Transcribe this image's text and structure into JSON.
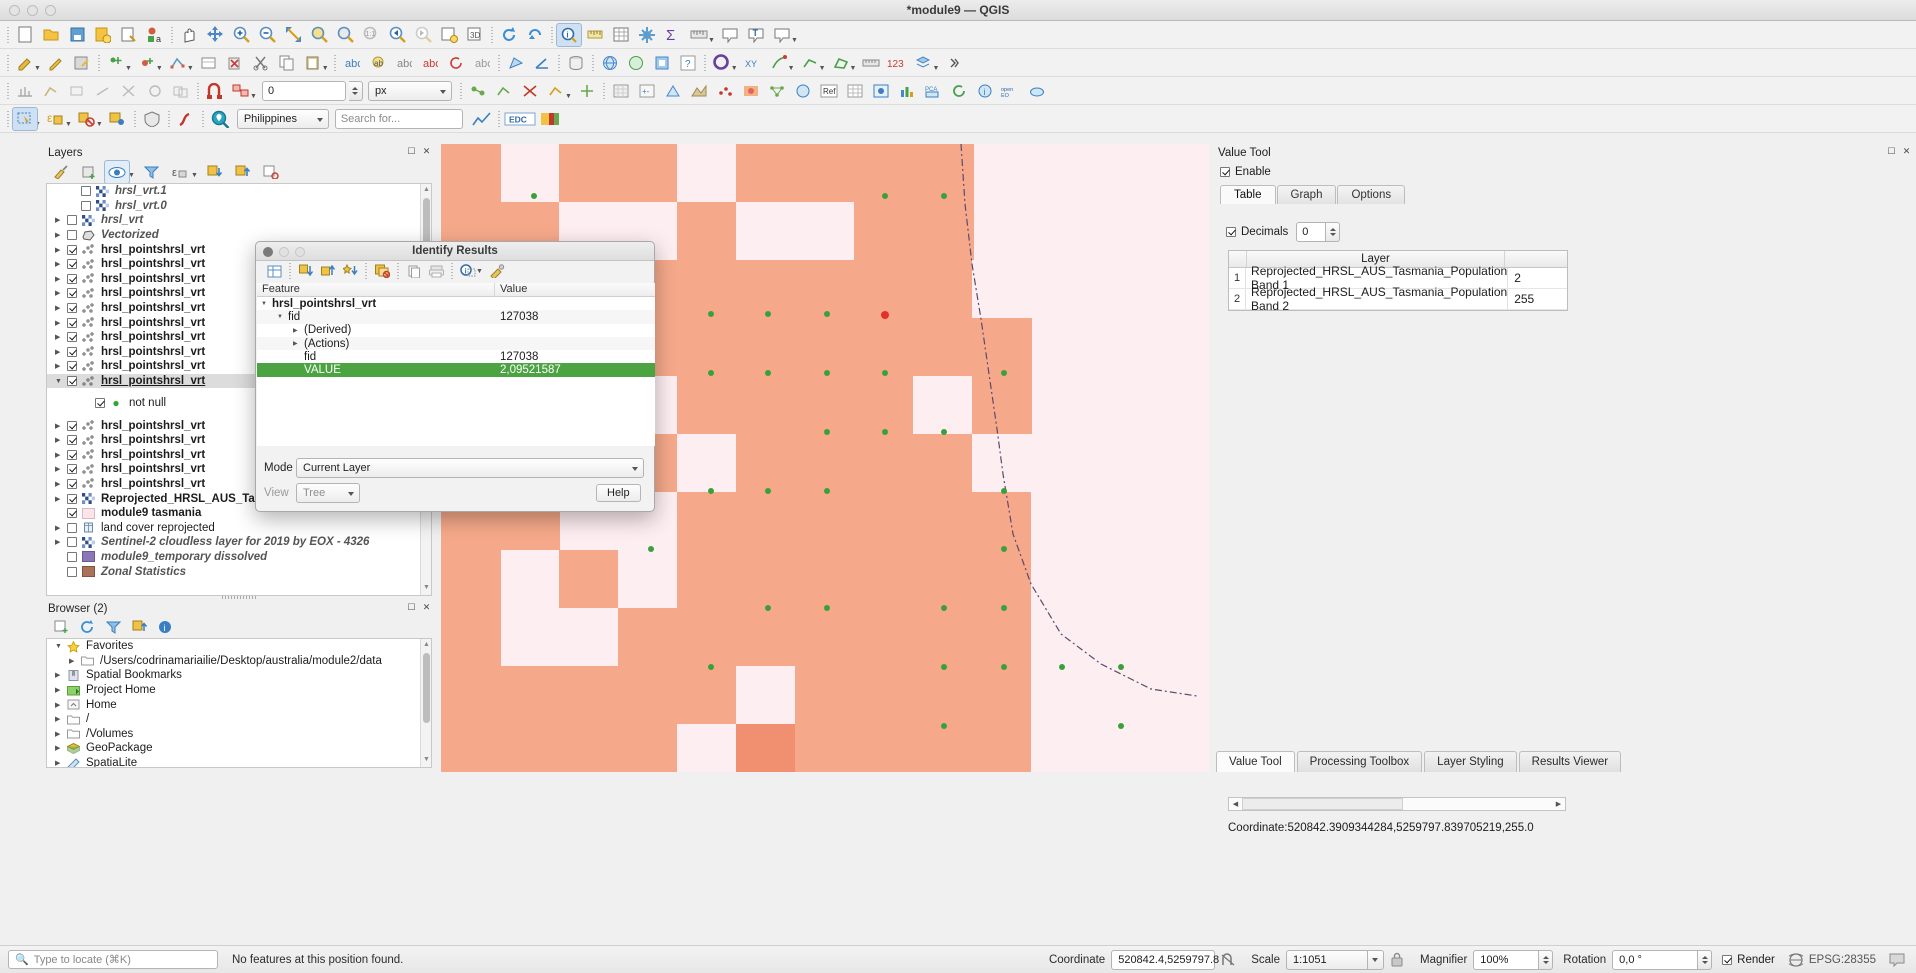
{
  "window": {
    "title": "*module9 — QGIS"
  },
  "toolbars": {
    "row1": [
      {
        "icon": "new-project-icon"
      },
      {
        "icon": "open-project-icon"
      },
      {
        "icon": "save-project-icon"
      },
      {
        "icon": "save-project-as-icon"
      },
      {
        "icon": "new-print-layout-icon"
      },
      {
        "icon": "style-manager-icon"
      },
      {
        "sep": true
      },
      {
        "icon": "pan-map-icon"
      },
      {
        "icon": "pan-to-selection-icon"
      },
      {
        "icon": "zoom-in-icon"
      },
      {
        "icon": "zoom-out-icon"
      },
      {
        "icon": "zoom-full-icon"
      },
      {
        "icon": "zoom-to-selection-icon"
      },
      {
        "icon": "zoom-to-layer-icon"
      },
      {
        "icon": "zoom-native-icon"
      },
      {
        "icon": "zoom-last-icon"
      },
      {
        "icon": "zoom-next-icon"
      },
      {
        "icon": "new-map-view-icon"
      },
      {
        "icon": "new-3d-map-view-icon"
      },
      {
        "sep": true
      },
      {
        "icon": "refresh-icon"
      },
      {
        "icon": "draw-map-icon"
      },
      {
        "sep": true
      },
      {
        "icon": "identify-features-icon",
        "active": true
      },
      {
        "icon": "measure-line-icon"
      },
      {
        "icon": "attribute-table-icon"
      },
      {
        "icon": "processing-toolbox-icon"
      },
      {
        "icon": "sum-statistics-icon"
      },
      {
        "icon": "measure-icon"
      },
      {
        "icon": "map-tips-icon"
      },
      {
        "icon": "text-annotation-icon"
      },
      {
        "icon": "annotation-icon"
      }
    ],
    "row2": [
      {
        "icon": "current-edits-icon"
      },
      {
        "icon": "toggle-editing-icon"
      },
      {
        "icon": "save-layer-edits-icon"
      },
      {
        "sep": true
      },
      {
        "icon": "add-feature-icon"
      },
      {
        "icon": "add-point-feature-icon"
      },
      {
        "icon": "vertex-tool-icon"
      },
      {
        "icon": "modify-attributes-icon"
      },
      {
        "icon": "delete-selected-icon"
      },
      {
        "icon": "cut-features-icon"
      },
      {
        "icon": "copy-features-icon"
      },
      {
        "icon": "paste-features-icon"
      },
      {
        "sep": true
      },
      {
        "icon": "label-icon"
      },
      {
        "icon": "pin-labels-icon"
      },
      {
        "icon": "show-hide-labels-icon"
      },
      {
        "icon": "move-label-icon"
      },
      {
        "icon": "rotate-label-icon"
      },
      {
        "icon": "change-label-icon"
      },
      {
        "sep": true
      },
      {
        "icon": "measure-area-icon"
      },
      {
        "icon": "measure-angle-icon"
      },
      {
        "sep": true
      },
      {
        "icon": "db-manager-icon"
      },
      {
        "sep": true
      },
      {
        "icon": "globe-icon"
      },
      {
        "icon": "metasearch-icon"
      },
      {
        "icon": "plugins-icon"
      },
      {
        "icon": "help-icon"
      },
      {
        "sep": true
      },
      {
        "icon": "circle-select-icon"
      },
      {
        "icon": "xy-tool-icon"
      },
      {
        "icon": "vector-point-icon"
      },
      {
        "icon": "vector-line-icon"
      },
      {
        "icon": "vector-polygon-icon"
      },
      {
        "icon": "ruler-icon"
      },
      {
        "icon": "numeric-123-icon"
      },
      {
        "icon": "layer-stack-icon"
      },
      {
        "icon": "chevron-right-icon"
      }
    ],
    "row3": [
      {
        "icon": "snapping-off-icon"
      },
      {
        "icon": "digitize-toggle-icon"
      },
      {
        "icon": "snap-vertex-icon"
      },
      {
        "icon": "snap-segment-icon"
      },
      {
        "icon": "snap-intersection-icon"
      },
      {
        "icon": "trace-icon"
      },
      {
        "icon": "avoid-overlap-icon"
      },
      {
        "sep": true
      },
      {
        "icon": "snapping-enable-icon",
        "active": true
      },
      {
        "icon": "snap-mode-icon"
      },
      {
        "widget": "tolerance",
        "value": "0"
      },
      {
        "widget": "units",
        "value": "px"
      },
      {
        "sep": true
      },
      {
        "icon": "topological-editing-icon"
      },
      {
        "icon": "self-snapping-icon"
      },
      {
        "icon": "no-overlap-icon"
      },
      {
        "icon": "point-marker-icon"
      },
      {
        "icon": "intersection-snap-icon"
      },
      {
        "sep": true
      },
      {
        "icon": "georeferencer-icon"
      },
      {
        "icon": "raster-calc-icon"
      },
      {
        "icon": "mesh-calc-icon"
      },
      {
        "icon": "terrain-icon"
      },
      {
        "icon": "interpolation-icon"
      },
      {
        "icon": "heatmap-icon"
      },
      {
        "icon": "network-analysis-icon"
      },
      {
        "icon": "qweb-icon"
      },
      {
        "icon": "ref-icon"
      },
      {
        "icon": "grid-icon"
      },
      {
        "icon": "semi-auto-icon"
      },
      {
        "icon": "stats-icon"
      },
      {
        "icon": "pca-icon"
      },
      {
        "icon": "swipe-icon"
      },
      {
        "icon": "info-layer-icon"
      },
      {
        "icon": "open-eo-icon"
      },
      {
        "icon": "cloud-icon"
      }
    ],
    "row4": [
      {
        "icon": "select-features-icon",
        "active": true
      },
      {
        "icon": "select-by-expression-icon"
      },
      {
        "icon": "deselect-icon"
      },
      {
        "icon": "select-value-icon"
      },
      {
        "sep": true
      },
      {
        "icon": "shield-icon"
      },
      {
        "sep": true
      },
      {
        "icon": "curve-icon"
      },
      {
        "sep": true
      },
      {
        "icon": "search-location-icon"
      },
      {
        "widget": "country",
        "value": "Philippines"
      },
      {
        "widget": "search",
        "value": "",
        "placeholder": "Search for..."
      },
      {
        "icon": "profile-chart-icon"
      },
      {
        "sep": true
      },
      {
        "icon": "edc-icon"
      },
      {
        "icon": "colorbar-icon"
      }
    ],
    "toleranceValue": "0",
    "unitsValue": "px",
    "countryValue": "Philippines",
    "searchPlaceholder": "Search for..."
  },
  "layers_panel": {
    "title": "Layers",
    "toolbar_icons": [
      "open-styling-panel-icon",
      "add-group-icon",
      "manage-visibility-icon",
      "filter-legend-icon",
      "filter-legend-expression-icon",
      "expand-all-icon",
      "collapse-all-icon",
      "remove-layer-icon"
    ],
    "items": [
      {
        "arrow": "",
        "checked": false,
        "label": "hrsl_vrt.1",
        "style": "it",
        "icon": "raster-icon",
        "indent": 1
      },
      {
        "arrow": "",
        "checked": false,
        "label": "hrsl_vrt.0",
        "style": "it",
        "icon": "raster-icon",
        "indent": 1
      },
      {
        "arrow": "closed",
        "checked": false,
        "label": "hrsl_vrt",
        "style": "it",
        "icon": "raster-icon",
        "indent": 0
      },
      {
        "arrow": "closed",
        "checked": false,
        "label": "Vectorized",
        "style": "it",
        "icon": "polygon-icon",
        "indent": 0
      },
      {
        "arrow": "closed",
        "checked": true,
        "label": "hrsl_pointshrsl_vrt",
        "style": "b",
        "icon": "points-icon",
        "indent": 0
      },
      {
        "arrow": "closed",
        "checked": true,
        "label": "hrsl_pointshrsl_vrt",
        "style": "b",
        "icon": "points-icon",
        "indent": 0
      },
      {
        "arrow": "closed",
        "checked": true,
        "label": "hrsl_pointshrsl_vrt",
        "style": "b",
        "icon": "points-icon",
        "indent": 0
      },
      {
        "arrow": "closed",
        "checked": true,
        "label": "hrsl_pointshrsl_vrt",
        "style": "b",
        "icon": "points-icon",
        "indent": 0
      },
      {
        "arrow": "closed",
        "checked": true,
        "label": "hrsl_pointshrsl_vrt",
        "style": "b",
        "icon": "points-icon",
        "indent": 0
      },
      {
        "arrow": "closed",
        "checked": true,
        "label": "hrsl_pointshrsl_vrt",
        "style": "b",
        "icon": "points-icon",
        "indent": 0
      },
      {
        "arrow": "closed",
        "checked": true,
        "label": "hrsl_pointshrsl_vrt",
        "style": "b",
        "icon": "points-icon",
        "indent": 0
      },
      {
        "arrow": "closed",
        "checked": true,
        "label": "hrsl_pointshrsl_vrt",
        "style": "b",
        "icon": "points-icon",
        "indent": 0
      },
      {
        "arrow": "closed",
        "checked": true,
        "label": "hrsl_pointshrsl_vrt",
        "style": "b",
        "icon": "points-icon",
        "indent": 0
      },
      {
        "arrow": "open",
        "checked": true,
        "label": "hrsl_pointshrsl_vrt",
        "style": "b ul",
        "icon": "points-icon",
        "indent": 0,
        "selected": true
      },
      {
        "arrow": "",
        "checked": true,
        "label": "not null",
        "style": "plain",
        "icon": "green-dot-icon",
        "indent": 2,
        "legend": true
      },
      {
        "arrow": "closed",
        "checked": true,
        "label": "hrsl_pointshrsl_vrt",
        "style": "b",
        "icon": "points-icon",
        "indent": 0
      },
      {
        "arrow": "closed",
        "checked": true,
        "label": "hrsl_pointshrsl_vrt",
        "style": "b",
        "icon": "points-icon",
        "indent": 0
      },
      {
        "arrow": "closed",
        "checked": true,
        "label": "hrsl_pointshrsl_vrt",
        "style": "b",
        "icon": "points-icon",
        "indent": 0
      },
      {
        "arrow": "closed",
        "checked": true,
        "label": "hrsl_pointshrsl_vrt",
        "style": "b",
        "icon": "points-icon",
        "indent": 0
      },
      {
        "arrow": "closed",
        "checked": true,
        "label": "hrsl_pointshrsl_vrt",
        "style": "b",
        "icon": "points-icon",
        "indent": 0
      },
      {
        "arrow": "closed",
        "checked": true,
        "label": "Reprojected_HRSL_AUS_Tasmania_Population",
        "style": "b",
        "icon": "raster-icon",
        "indent": 0
      },
      {
        "arrow": "",
        "checked": true,
        "label": "module9 tasmania",
        "style": "b",
        "icon": "pink-swatch-icon",
        "indent": 0
      },
      {
        "arrow": "closed",
        "checked": false,
        "label": "land cover reprojected",
        "style": "plain",
        "icon": "mesh-icon",
        "indent": 0
      },
      {
        "arrow": "closed",
        "checked": false,
        "label": "Sentinel-2 cloudless layer for 2019 by EOX - 4326",
        "style": "it",
        "icon": "raster-icon",
        "indent": 0
      },
      {
        "arrow": "",
        "checked": false,
        "label": "module9_temporary dissolved",
        "style": "it",
        "icon": "purple-swatch-icon",
        "indent": 0
      },
      {
        "arrow": "",
        "checked": false,
        "label": "Zonal Statistics",
        "style": "it",
        "icon": "brown-swatch-icon",
        "indent": 0
      }
    ]
  },
  "browser_panel": {
    "title": "Browser (2)",
    "toolbar_icons": [
      "add-layer-icon",
      "refresh-icon",
      "filter-browser-icon",
      "collapse-all-icon",
      "properties-icon"
    ],
    "items": [
      {
        "arrow": "open",
        "label": "Favorites",
        "icon": "star-icon",
        "indent": 0
      },
      {
        "arrow": "closed",
        "label": "/Users/codrinamariailie/Desktop/australia/module2/data",
        "icon": "folder-icon",
        "indent": 1
      },
      {
        "arrow": "closed",
        "label": "Spatial Bookmarks",
        "icon": "bookmark-icon",
        "indent": 0
      },
      {
        "arrow": "closed",
        "label": "Project Home",
        "icon": "project-home-icon",
        "indent": 0
      },
      {
        "arrow": "closed",
        "label": "Home",
        "icon": "home-icon",
        "indent": 0
      },
      {
        "arrow": "closed",
        "label": "/",
        "icon": "folder-icon",
        "indent": 0
      },
      {
        "arrow": "closed",
        "label": "/Volumes",
        "icon": "folder-icon",
        "indent": 0
      },
      {
        "arrow": "closed",
        "label": "GeoPackage",
        "icon": "geopackage-icon",
        "indent": 0
      },
      {
        "arrow": "closed",
        "label": "SpatiaLite",
        "icon": "spatialite-icon",
        "indent": 0
      }
    ]
  },
  "identify_dialog": {
    "title": "Identify Results",
    "toolbar_icons": [
      "expand-new-icon",
      "expand-all-icon",
      "collapse-all-icon",
      "highlight-all-icon",
      "clear-results-icon",
      "copy-icon",
      "print-icon",
      "identify-settings-icon",
      "chevron-down-icon",
      "wrench-icon"
    ],
    "columns": {
      "feature": "Feature",
      "value": "Value"
    },
    "rows": [
      {
        "arrow": "open",
        "indent": 0,
        "label": "hrsl_pointshrsl_vrt",
        "value": "",
        "bold": true
      },
      {
        "arrow": "open",
        "indent": 1,
        "label": "fid",
        "value": "127038"
      },
      {
        "arrow": "closed",
        "indent": 2,
        "label": "(Derived)",
        "value": ""
      },
      {
        "arrow": "closed",
        "indent": 2,
        "label": "(Actions)",
        "value": ""
      },
      {
        "arrow": "",
        "indent": 2,
        "label": "fid",
        "value": "127038"
      },
      {
        "arrow": "",
        "indent": 2,
        "label": "VALUE",
        "value": "2,09521587",
        "highlight": true
      }
    ],
    "mode_label": "Mode",
    "mode_value": "Current Layer",
    "view_label": "View",
    "view_value": "Tree",
    "help_label": "Help"
  },
  "value_tool": {
    "title": "Value Tool",
    "enable_label": "Enable",
    "enable_checked": true,
    "tabs": [
      {
        "label": "Table",
        "active": true
      },
      {
        "label": "Graph",
        "active": false
      },
      {
        "label": "Options",
        "active": false
      }
    ],
    "decimals_label": "Decimals",
    "decimals_checked": true,
    "decimals_value": "0",
    "table_header": {
      "index": "",
      "layer": "Layer",
      "value": ""
    },
    "table_rows": [
      {
        "index": "1",
        "layer": "Reprojected_HRSL_AUS_Tasmania_Population Band 1",
        "value": "2"
      },
      {
        "index": "2",
        "layer": "Reprojected_HRSL_AUS_Tasmania_Population Band 2",
        "value": "255"
      }
    ],
    "coordinate": "Coordinate:520842.3909344284,5259797.839705219,255.0"
  },
  "dock_tabs": [
    {
      "label": "Value Tool",
      "active": true
    },
    {
      "label": "Processing Toolbox",
      "active": false
    },
    {
      "label": "Layer Styling",
      "active": false
    },
    {
      "label": "Results Viewer",
      "active": false
    }
  ],
  "status_bar": {
    "locator_placeholder": "Type to locate (⌘K)",
    "message": "No features at this position found.",
    "coordinate_label": "Coordinate",
    "coordinate_value": "520842.4,5259797.8",
    "scale_label": "Scale",
    "scale_value": "1:1051",
    "magnifier_label": "Magnifier",
    "magnifier_value": "100%",
    "rotation_label": "Rotation",
    "rotation_value": "0,0 °",
    "render_label": "Render",
    "render_checked": true,
    "crs_label": "EPSG:28355",
    "messages_icon": "messages-icon"
  },
  "colors": {
    "accent_green": "#4ba342",
    "map_cell": "#f6a98a",
    "map_bg": "#fdeef1",
    "point_green": "#3aa13a",
    "point_selected": "#e8302a"
  }
}
